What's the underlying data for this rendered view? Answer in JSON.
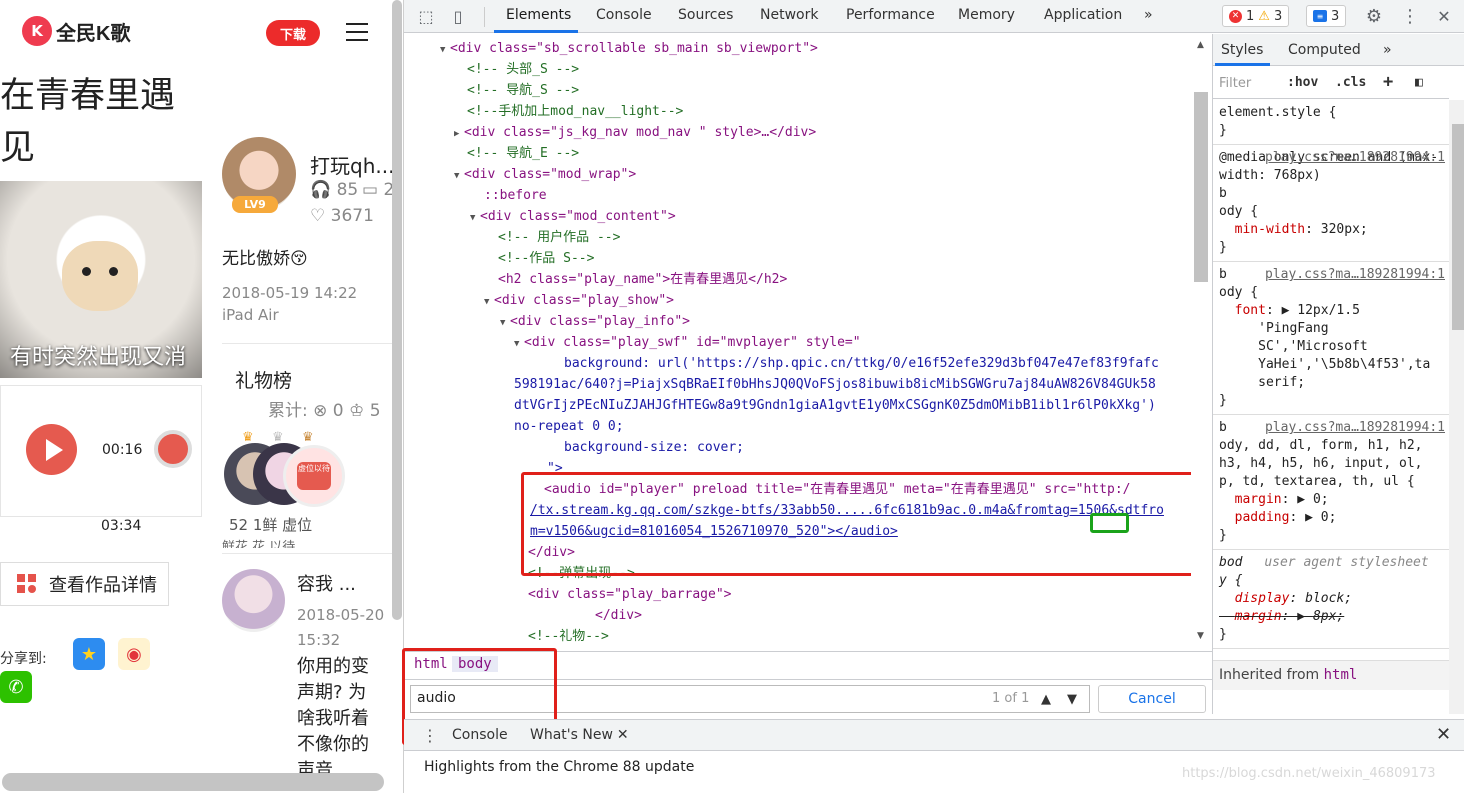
{
  "page": {
    "logo_mark": "K",
    "logo_text": "全民K歌",
    "download_label": "下载",
    "song_title": "在青春里遇见",
    "cover_caption": "有时突然出现又消",
    "current_time": "00:16",
    "total_time": "03:34",
    "detail_button": "查看作品详情",
    "share_label": "分享到:",
    "user": {
      "name": "打玩qh...",
      "level": "LV9",
      "listens": "85",
      "comments": "2",
      "flowers": "3671",
      "desc": "无比傲娇😚",
      "date": "2018-05-19 14:22 iPad Air"
    },
    "gifts": {
      "title": "礼物榜",
      "count_label": "累计:",
      "count_a": "0",
      "count_b": "5",
      "stat": "52  1鲜 虚位",
      "sub": "鲜花  花 以待"
    },
    "comment": {
      "user": "容我 ...",
      "date": "2018-05-20 15:32",
      "text": "你用的变声期? 为啥我听着不像你的声音"
    }
  },
  "devtools": {
    "tabs": [
      "Elements",
      "Console",
      "Sources",
      "Network",
      "Performance",
      "Memory",
      "Application"
    ],
    "more_tabs": "»",
    "errors": "1",
    "warnings": "3",
    "infos": "3",
    "settings_icon": "⚙",
    "kebab_icon": "⋮",
    "close_icon": "✕",
    "dom": [
      {
        "text": "<div class=\"sb_scrollable sb_main sb_viewport\">"
      },
      {
        "text": "<!-- 头部_S -->"
      },
      {
        "text": "<!-- 导航_S -->"
      },
      {
        "text": "<!--手机加上mod_nav__light-->"
      },
      {
        "text": "<div class=\"js_kg_nav mod_nav \" style>…</div>"
      },
      {
        "text": "<!-- 导航_E -->"
      },
      {
        "text": "<div class=\"mod_wrap\">"
      },
      {
        "text": "::before"
      },
      {
        "text": "<div class=\"mod_content\">"
      },
      {
        "text": "<!-- 用户作品 -->"
      },
      {
        "text": "<!--作品 S-->"
      },
      {
        "text": "<h2 class=\"play_name\">在青春里遇见</h2>"
      },
      {
        "text": "<div class=\"play_show\">"
      },
      {
        "text": "<div class=\"play_info\">"
      },
      {
        "text": "<div class=\"play_swf\" id=\"mvplayer\" style=\""
      },
      {
        "text": "background: url('https://shp.qpic.cn/ttkg/0/e16f52efe329d3bf047e47ef83f9fafc"
      },
      {
        "text": "598191ac/640?j=PiajxSqBRaEIf0bHhsJQ0QVoFSjos8ibuwib8icMibSGWGru7aj84uAW826V84GUk58"
      },
      {
        "text": "dtVGrIjzPEcNIuZJAHJGfHTEGw8a9t9Gndn1giaA1gvtE1y0MxCSGgnK0Z5dmOMibB1ibl1r6lP0kXkg')"
      },
      {
        "text": "no-repeat 0 0;"
      },
      {
        "text": "background-size: cover;"
      },
      {
        "text": "\">"
      },
      {
        "text": "<audio id=\"player\" preload title=\"在青春里遇见\" meta=\"在青春里遇见\" src=\"http:/"
      },
      {
        "text": "/tx.stream.kg.qq.com/szkge-btfs/33abb50.....6fc6181b9ac.0.m4a&fromtag=1506&sdtfro"
      },
      {
        "text": "m=v1506&ugcid=81016054_1526710970_520\"></audio>"
      },
      {
        "text": "</div>"
      },
      {
        "text": "<!--弹幕出现-->"
      },
      {
        "text": "<div class=\"play_barrage\">"
      },
      {
        "text": "</div>"
      },
      {
        "text": "<!--礼物-->"
      }
    ],
    "styles": {
      "tabs": [
        "Styles",
        "Computed"
      ],
      "filter_placeholder": "Filter",
      "hov": ":hov",
      "cls": ".cls",
      "inherited_label": "Inherited from",
      "inherited_tag": "html"
    },
    "breadcrumbs": [
      "html",
      "body"
    ],
    "search": {
      "value": "audio",
      "count": "1 of 1",
      "cancel": "Cancel"
    },
    "drawer": {
      "tabs": [
        "Console",
        "What's New"
      ],
      "message": "Highlights from the Chrome 88 update",
      "watermark": "https://blog.csdn.net/weixin_46809173"
    }
  }
}
